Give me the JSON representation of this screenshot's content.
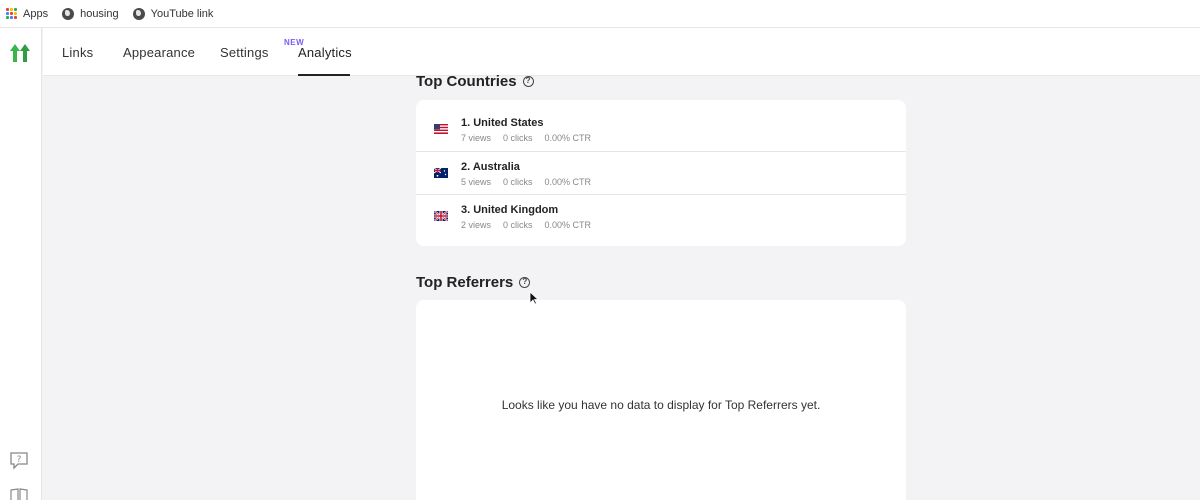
{
  "bookmarks": [
    {
      "label": "Apps",
      "icon": "apps-grid-icon"
    },
    {
      "label": "housing",
      "icon": "globe-icon"
    },
    {
      "label": "YouTube link",
      "icon": "globe-icon"
    }
  ],
  "nav": {
    "tabs": [
      {
        "label": "Links"
      },
      {
        "label": "Appearance"
      },
      {
        "label": "Settings"
      },
      {
        "label": "Analytics",
        "badge": "NEW",
        "active": true
      }
    ]
  },
  "top_countries": {
    "title": "Top Countries",
    "rows": [
      {
        "name": "1. United States",
        "views": "7 views",
        "clicks": "0 clicks",
        "ctr": "0.00% CTR",
        "flag": "us-flag-icon"
      },
      {
        "name": "2. Australia",
        "views": "5 views",
        "clicks": "0 clicks",
        "ctr": "0.00% CTR",
        "flag": "au-flag-icon"
      },
      {
        "name": "3. United Kingdom",
        "views": "2 views",
        "clicks": "0 clicks",
        "ctr": "0.00% CTR",
        "flag": "uk-flag-icon"
      }
    ]
  },
  "top_referrers": {
    "title": "Top Referrers",
    "empty_message": "Looks like you have no data to display for Top Referrers yet."
  },
  "colors": {
    "accent": "#7a5af8",
    "logo_green": "#39b54a"
  }
}
